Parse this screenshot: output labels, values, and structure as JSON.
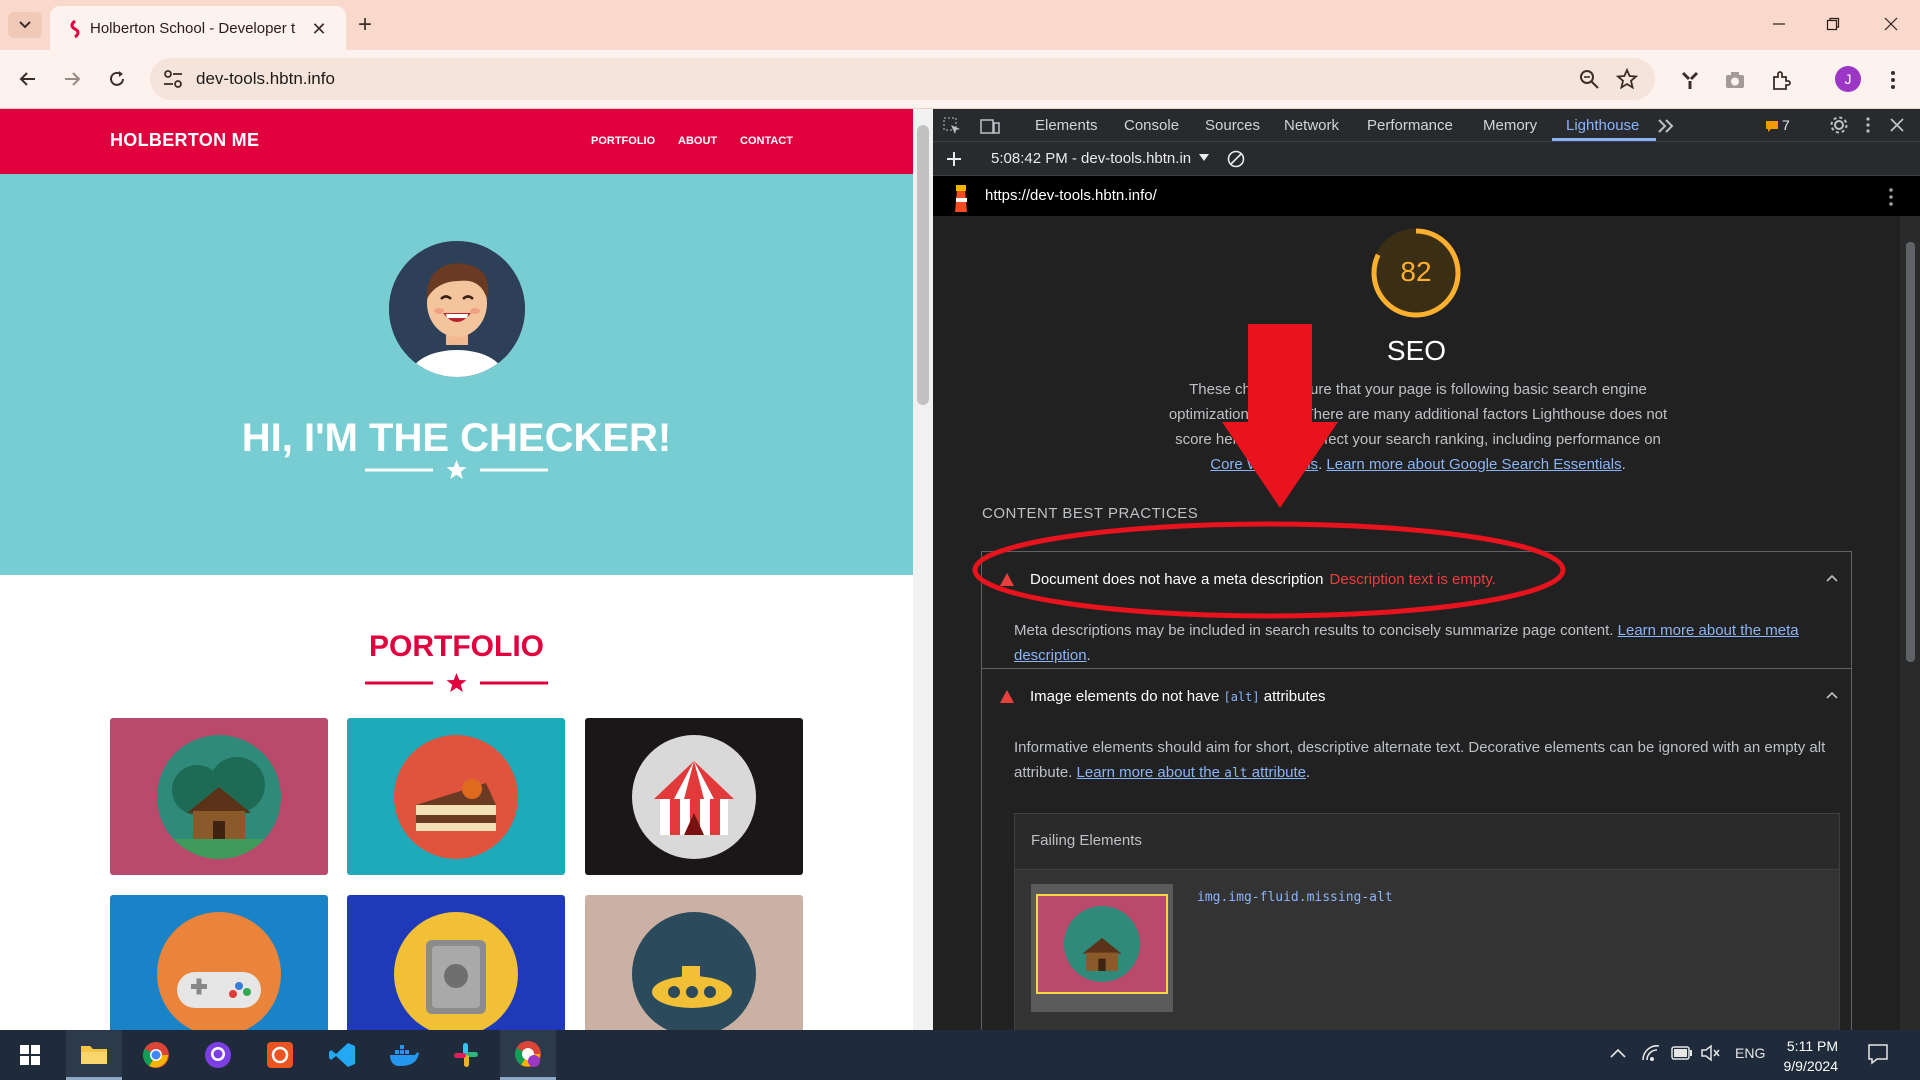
{
  "browser": {
    "tab_title": "Holberton School - Developer t",
    "url": "dev-tools.hbtn.info",
    "profile_initial": "J"
  },
  "site": {
    "brand": "HOLBERTON ME",
    "nav": [
      "PORTFOLIO",
      "ABOUT",
      "CONTACT"
    ],
    "hero_title": "HI, I'M THE CHECKER!",
    "portfolio_title": "PORTFOLIO",
    "tile_colors": [
      "#b94a6c",
      "#1eaab8",
      "#1b1617",
      "#1a82c7",
      "#1e3ab8",
      "#cbb1a3"
    ]
  },
  "devtools": {
    "tabs": [
      "Elements",
      "Console",
      "Sources",
      "Network",
      "Performance",
      "Memory",
      "Lighthouse"
    ],
    "issues_count": "7",
    "report_select": "5:08:42 PM - dev-tools.hbtn.in",
    "lighthouse_url": "https://dev-tools.hbtn.info/",
    "score": "82",
    "score_fraction": 0.82,
    "category_title": "SEO",
    "category_desc_1": "These checks ensure that your page is following basic search engine optimization advice. There are many additional factors Lighthouse does not score here that may affect your search ranking, including performance on ",
    "category_desc_link1": "Core Web Vitals",
    "category_desc_sep": ". ",
    "category_desc_link2": "Learn more about Google Search Essentials",
    "category_desc_end": ".",
    "group_title": "CONTENT BEST PRACTICES",
    "audit1": {
      "title": "Document does not have a meta description",
      "display_value": "Description text is empty.",
      "desc": "Meta descriptions may be included in search results to concisely summarize page content. ",
      "link": "Learn more about the meta description",
      "end": "."
    },
    "audit2": {
      "title_pre": "Image elements do not have ",
      "title_code": "[alt]",
      "title_post": " attributes",
      "desc": "Informative elements should aim for short, descriptive alternate text. Decorative elements can be ignored with an empty alt attribute. ",
      "link_pre": "Learn more about the ",
      "link_code": "alt",
      "link_post": " attribute",
      "end": ".",
      "failing_label": "Failing Elements",
      "selector": "img.img-fluid.missing-alt"
    }
  },
  "taskbar": {
    "language": "ENG",
    "time": "5:11 PM",
    "date": "9/9/2024"
  },
  "colors": {
    "brand_red": "#e1003d",
    "hero_teal": "#77cdd2",
    "score_orange": "#fdb02f",
    "annotation_red": "#e8131d",
    "link_blue": "#8ab4f8"
  }
}
